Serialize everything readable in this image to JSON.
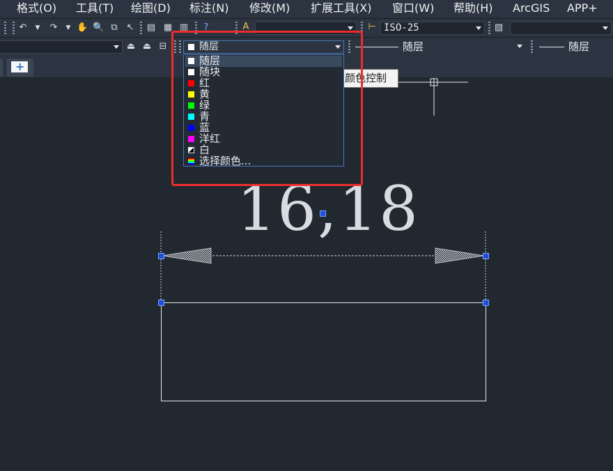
{
  "menubar": {
    "items": [
      "格式(O)",
      "工具(T)",
      "绘图(D)",
      "标注(N)",
      "修改(M)",
      "扩展工具(X)",
      "窗口(W)",
      "帮助(H)",
      "ArcGIS",
      "APP+"
    ]
  },
  "toolbar1": {
    "dimstyle_value": "ISO-25"
  },
  "toolbar2": {
    "color_value": "随层",
    "linetype_value": "随层",
    "lineweight_value": "随层"
  },
  "tooltip": {
    "text": "颜色控制"
  },
  "color_dropdown": {
    "items": [
      {
        "label": "随层",
        "color": "#ffffff"
      },
      {
        "label": "随块",
        "color": "#ffffff"
      },
      {
        "label": "红",
        "color": "#ff0000"
      },
      {
        "label": "黄",
        "color": "#ffff00"
      },
      {
        "label": "绿",
        "color": "#00ff00"
      },
      {
        "label": "青",
        "color": "#00ffff"
      },
      {
        "label": "蓝",
        "color": "#0000ff"
      },
      {
        "label": "洋红",
        "color": "#ff00ff"
      },
      {
        "label": "白",
        "color": "#ffffff"
      },
      {
        "label": "选择颜色...",
        "color": "rainbow"
      }
    ],
    "selected_index": 0
  },
  "drawing": {
    "dimension_text": "16,18"
  },
  "colors": {
    "highlight_box": "#ee2c2c",
    "grip": "#1f4fd8",
    "background": "#212830"
  }
}
